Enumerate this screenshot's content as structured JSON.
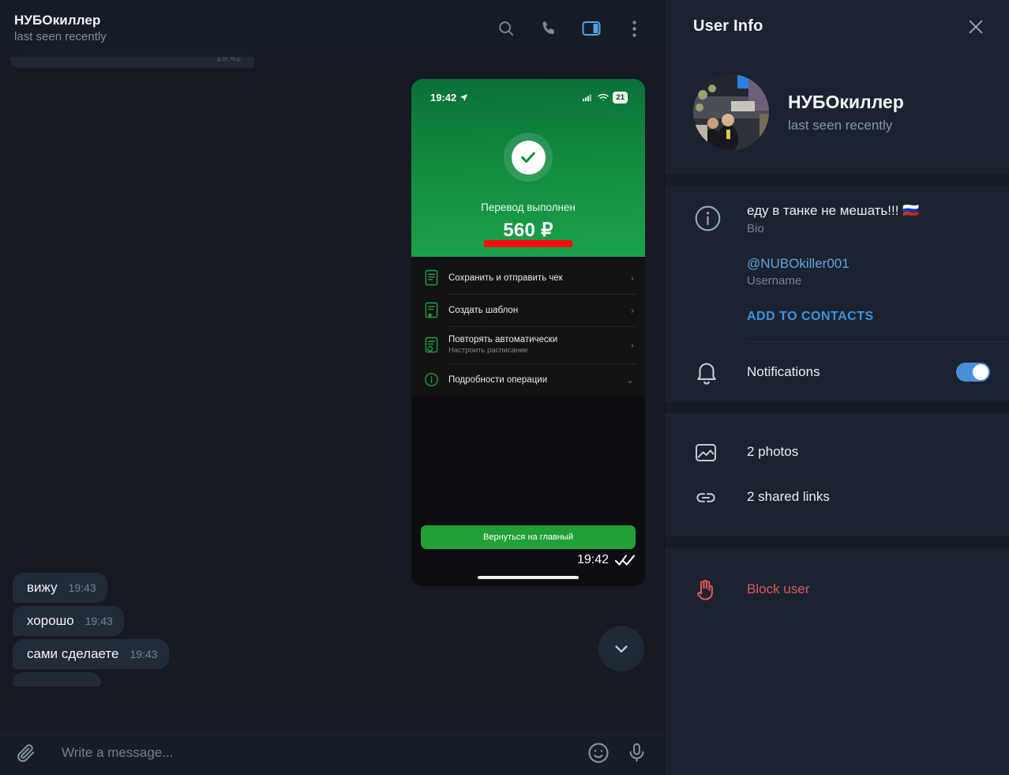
{
  "chat": {
    "header": {
      "title": "НУБОкиллер",
      "subtitle": "last seen recently",
      "icons": {
        "search": "search-icon",
        "call": "phone-icon",
        "info_panel": "info-panel-icon",
        "menu": "more-vertical-icon"
      }
    },
    "partial_top_message": {
      "time": "19:42"
    },
    "photo_message": {
      "time": "19:42",
      "read_status": "✓✓",
      "phone_screenshot": {
        "status_bar": {
          "time": "19:42",
          "location_icon": "location-arrow-icon",
          "signal": "cellular-icon",
          "wifi": "wifi-icon",
          "battery": "21"
        },
        "result": {
          "caption": "Перевод выполнен",
          "amount": "560 ₽",
          "redacted": true
        },
        "menu_items": [
          {
            "label": "Сохранить и отправить чек",
            "sub": "",
            "chevron": "›",
            "icon": "receipt-icon"
          },
          {
            "label": "Создать шаблон",
            "sub": "",
            "chevron": "›",
            "icon": "template-star-icon"
          },
          {
            "label": "Повторять автоматически",
            "sub": "Настроить расписание",
            "chevron": "›",
            "icon": "repeat-schedule-icon"
          },
          {
            "label": "Подробности операции",
            "sub": "",
            "chevron": "⌄",
            "icon": "info-circle-icon"
          }
        ],
        "cta_button": "Вернуться на главный"
      }
    },
    "incoming_messages": [
      {
        "text": "вижу",
        "time": "19:43"
      },
      {
        "text": "хорошо",
        "time": "19:43"
      },
      {
        "text": "сами сделаете",
        "time": "19:43"
      }
    ],
    "scroll_down_icon": "chevron-down-icon",
    "composer": {
      "attach_icon": "paperclip-icon",
      "placeholder": "Write a message...",
      "emoji_icon": "smiley-icon",
      "mic_icon": "microphone-icon"
    }
  },
  "info_panel": {
    "title": "User Info",
    "close_icon": "close-icon",
    "profile": {
      "name": "НУБОкиллер",
      "status": "last seen recently"
    },
    "bio": {
      "icon": "info-circle-icon",
      "text": "еду в танке не мешать!!! 🇷🇺",
      "label": "Bio"
    },
    "username": {
      "value": "@NUBOkiller001",
      "label": "Username"
    },
    "add_to_contacts": "ADD TO CONTACTS",
    "notifications": {
      "icon": "bell-icon",
      "label": "Notifications",
      "enabled": true
    },
    "media": [
      {
        "icon": "photo-icon",
        "label": "2 photos"
      },
      {
        "icon": "link-icon",
        "label": "2 shared links"
      }
    ],
    "block_user": {
      "icon": "block-hand-icon",
      "label": "Block user"
    }
  },
  "colors": {
    "chat_bg": "#151a23",
    "panel_bg": "#1b2330",
    "bubble_in": "#222c39",
    "accent_blue": "#4a90d9",
    "link_blue": "#62a3e0",
    "danger_red": "#e2565c",
    "sber_green": "#21a038"
  }
}
